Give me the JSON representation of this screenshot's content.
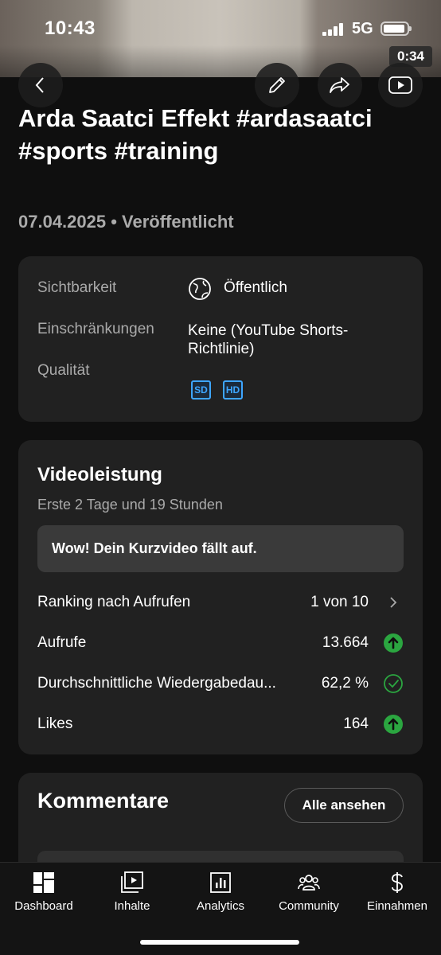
{
  "status_bar": {
    "time": "10:43",
    "network": "5G"
  },
  "video": {
    "duration": "0:34"
  },
  "header_icons": {
    "back": "back-arrow-icon",
    "edit": "pencil-icon",
    "share": "share-icon",
    "youtube": "youtube-play-icon"
  },
  "title": "Arda Saatci Effekt #ardasaatci #sports #training",
  "meta": "07.04.2025 • Veröffentlicht",
  "details": {
    "visibility_label": "Sichtbarkeit",
    "visibility_value": "Öffentlich",
    "restrictions_label": "Einschränkungen",
    "restrictions_value": "Keine (YouTube Shorts-Richtlinie)",
    "quality_label": "Qualität",
    "quality_badges": [
      "SD",
      "HD"
    ],
    "accent_color": "#3ea6ff"
  },
  "performance": {
    "title": "Videoleistung",
    "subtitle": "Erste 2 Tage und 19 Stunden",
    "banner": "Wow! Dein Kurzvideo fällt auf.",
    "rows": [
      {
        "label": "Ranking nach Aufrufen",
        "value": "1 von 10",
        "icon": "chevron-right-icon"
      },
      {
        "label": "Aufrufe",
        "value": "13.664",
        "icon": "up-arrow-icon"
      },
      {
        "label": "Durchschnittliche Wiedergabedau...",
        "value": "62,2 %",
        "icon": "check-circle-icon"
      },
      {
        "label": "Likes",
        "value": "164",
        "icon": "up-arrow-icon"
      }
    ],
    "positive_color": "#2ba640"
  },
  "comments": {
    "title": "Kommentare",
    "see_all": "Alle ansehen"
  },
  "bottom_nav": [
    {
      "label": "Dashboard",
      "icon": "dashboard-icon"
    },
    {
      "label": "Inhalte",
      "icon": "content-icon"
    },
    {
      "label": "Analytics",
      "icon": "analytics-icon"
    },
    {
      "label": "Community",
      "icon": "community-icon"
    },
    {
      "label": "Einnahmen",
      "icon": "dollar-icon"
    }
  ]
}
